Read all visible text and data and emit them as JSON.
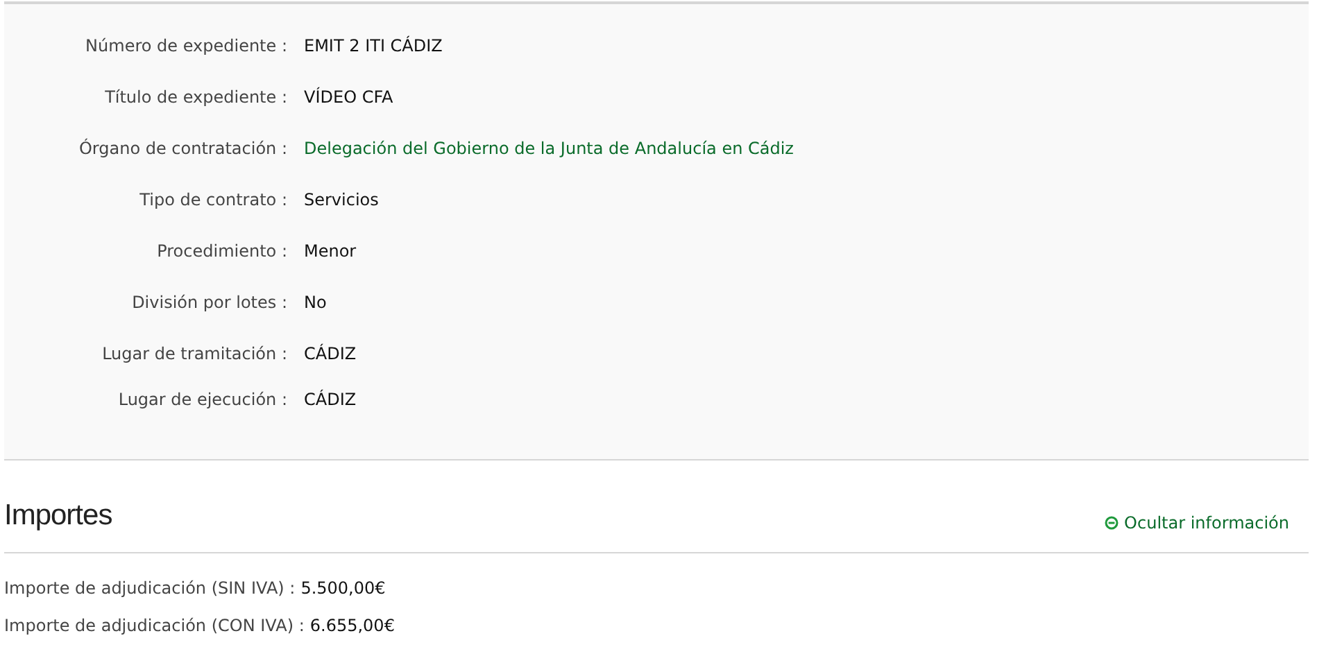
{
  "details": [
    {
      "label": "Número de expediente :",
      "value": "EMIT 2 ITI CÁDIZ",
      "kind": "text"
    },
    {
      "label": "Título de expediente :",
      "value": "VÍDEO CFA",
      "kind": "text"
    },
    {
      "label": "Órgano de contratación :",
      "value": "Delegación del Gobierno de la Junta de Andalucía en Cádiz",
      "kind": "link"
    },
    {
      "label": "Tipo de contrato :",
      "value": "Servicios",
      "kind": "text"
    },
    {
      "label": "Procedimiento :",
      "value": "Menor",
      "kind": "text"
    },
    {
      "label": "División por lotes :",
      "value": "No",
      "kind": "text"
    },
    {
      "label": "Lugar de tramitación :",
      "value": "CÁDIZ",
      "kind": "text"
    },
    {
      "label": "Lugar de ejecución :",
      "value": "CÁDIZ",
      "kind": "text"
    }
  ],
  "importes": {
    "title": "Importes",
    "toggle": "Ocultar información",
    "expanded": true,
    "rows": [
      {
        "label": "Importe de adjudicación (SIN IVA) :",
        "value": "5.500,00€"
      },
      {
        "label": "Importe de adjudicación (CON IVA) :",
        "value": "6.655,00€"
      }
    ]
  }
}
